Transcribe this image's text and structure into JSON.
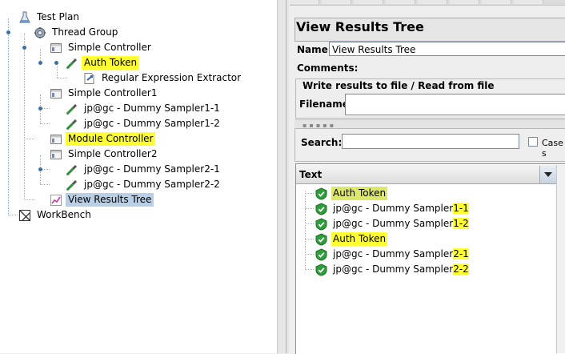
{
  "tree": {
    "nodes": [
      {
        "label": "Test Plan",
        "icon": "test-plan-icon"
      },
      {
        "label": "Thread Group",
        "icon": "thread-group-icon"
      },
      {
        "label": "Simple Controller",
        "icon": "controller-icon"
      },
      {
        "label": "Auth Token",
        "icon": "sampler-icon"
      },
      {
        "label": "Regular Expression Extractor",
        "icon": "extractor-icon"
      },
      {
        "label": "Simple Controller1",
        "icon": "controller-icon"
      },
      {
        "label": "jp@gc - Dummy Sampler1-1",
        "icon": "sampler-icon"
      },
      {
        "label": "jp@gc - Dummy Sampler1-2",
        "icon": "sampler-icon"
      },
      {
        "label": "Module Controller",
        "icon": "controller-icon"
      },
      {
        "label": "Simple Controller2",
        "icon": "controller-icon"
      },
      {
        "label": "jp@gc - Dummy Sampler2-1",
        "icon": "sampler-icon"
      },
      {
        "label": "jp@gc - Dummy Sampler2-2",
        "icon": "sampler-icon"
      },
      {
        "label": "View Results Tree",
        "icon": "chart-icon"
      },
      {
        "label": "WorkBench",
        "icon": "workbench-icon"
      }
    ]
  },
  "panel": {
    "title": "View Results Tree",
    "name_label": "Name:",
    "name_value": "View Results Tree",
    "comments_label": "Comments:",
    "file_group_title": "Write results to file / Read from file",
    "filename_label": "Filename",
    "filename_value": "",
    "search_label": "Search:",
    "search_value": "",
    "case_label": "Case s",
    "results_header": "Text",
    "results": [
      {
        "text": "Auth Token",
        "plain": "Auth Token",
        "hl": ""
      },
      {
        "text": "jp@gc - Dummy Sampler1-1",
        "plain": "jp@gc - Dummy Sampler",
        "hl": "1-1"
      },
      {
        "text": "jp@gc - Dummy Sampler1-2",
        "plain": "jp@gc - Dummy Sampler",
        "hl": "1-2"
      },
      {
        "text": "Auth Token",
        "plain": "Auth Token",
        "hl": ""
      },
      {
        "text": "jp@gc - Dummy Sampler2-1",
        "plain": "jp@gc - Dummy Sampler",
        "hl": "2-1"
      },
      {
        "text": "jp@gc - Dummy Sampler2-2",
        "plain": "jp@gc - Dummy Sampler",
        "hl": "2-2"
      }
    ]
  },
  "colors": {
    "highlight": "#ffff33",
    "selection": "#b8cfe5",
    "success_green": "#2e9e3a"
  }
}
